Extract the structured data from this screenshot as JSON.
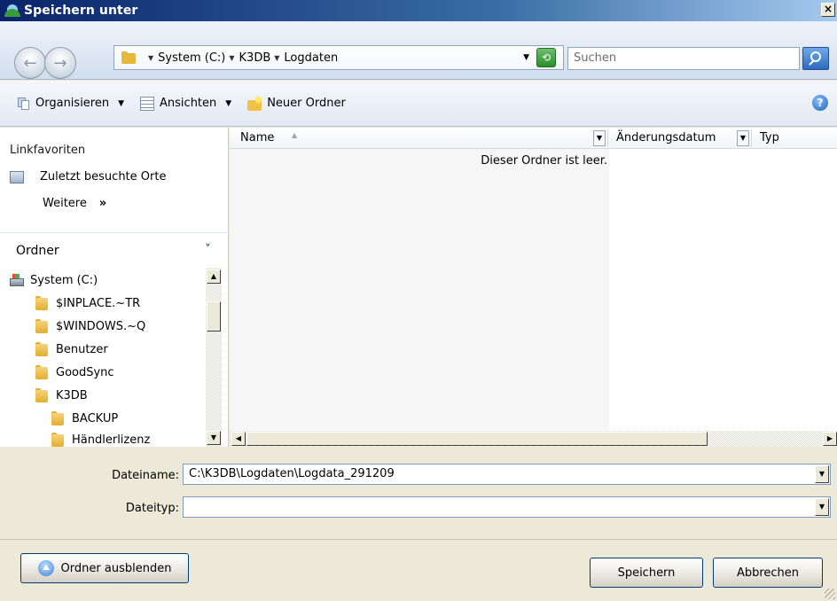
{
  "window": {
    "title": "Speichern unter",
    "close_symbol": "×"
  },
  "address": {
    "path": [
      "System (C:)",
      "K3DB",
      "Logdaten"
    ],
    "search_placeholder": "Suchen"
  },
  "toolbar": {
    "organize_label": "Organisieren",
    "views_label": "Ansichten",
    "new_folder_label": "Neuer Ordner",
    "help_symbol": "?"
  },
  "nav": {
    "favorites_header": "Linkfavoriten",
    "favorites": [
      "Zuletzt besuchte Orte"
    ],
    "more_label": "Weitere",
    "more_chevron": "»",
    "folders_header": "Ordner",
    "tree": [
      {
        "label": "System (C:)",
        "type": "drive",
        "level": 0
      },
      {
        "label": "$INPLACE.~TR",
        "type": "folder",
        "level": 1
      },
      {
        "label": "$WINDOWS.~Q",
        "type": "folder",
        "level": 1
      },
      {
        "label": "Benutzer",
        "type": "folder",
        "level": 1
      },
      {
        "label": "GoodSync",
        "type": "folder",
        "level": 1
      },
      {
        "label": "K3DB",
        "type": "folder",
        "level": 1
      },
      {
        "label": "BACKUP",
        "type": "folder",
        "level": 2
      },
      {
        "label": "Händlerlizenz",
        "type": "folder",
        "level": 2
      }
    ]
  },
  "filelist": {
    "columns": [
      "Name",
      "Änderungsdatum",
      "Typ"
    ],
    "sort_column": "Name",
    "empty_message": "Dieser Ordner ist leer."
  },
  "form": {
    "filename_label": "Dateiname:",
    "filename_value": "C:\\K3DB\\Logdaten\\Logdata_291209",
    "filetype_label": "Dateityp:",
    "filetype_value": ""
  },
  "buttons": {
    "hide_folders": "Ordner ausblenden",
    "save": "Speichern",
    "cancel": "Abbrechen"
  }
}
